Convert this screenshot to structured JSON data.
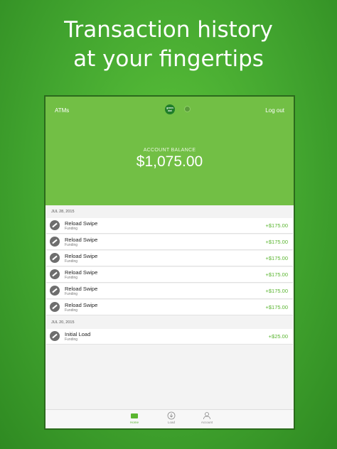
{
  "headline": {
    "line1": "Transaction history",
    "line2": "at your fingertips"
  },
  "topbar": {
    "left_link": "ATMs",
    "logo_text": "green dot",
    "right_link": "Log out"
  },
  "balance": {
    "label": "ACCOUNT BALANCE",
    "amount": "$1,075.00"
  },
  "groups": [
    {
      "date": "JUL 28, 2015",
      "items": [
        {
          "title": "Reload Swipe",
          "subtitle": "Funding",
          "amount": "+$175.00"
        },
        {
          "title": "Reload Swipe",
          "subtitle": "Funding",
          "amount": "+$175.00"
        },
        {
          "title": "Reload Swipe",
          "subtitle": "Funding",
          "amount": "+$175.00"
        },
        {
          "title": "Reload Swipe",
          "subtitle": "Funding",
          "amount": "+$175.00"
        },
        {
          "title": "Reload Swipe",
          "subtitle": "Funding",
          "amount": "+$175.00"
        },
        {
          "title": "Reload Swipe",
          "subtitle": "Funding",
          "amount": "+$175.00"
        }
      ]
    },
    {
      "date": "JUL 20, 2015",
      "items": [
        {
          "title": "Initial Load",
          "subtitle": "Funding",
          "amount": "+$25.00"
        }
      ]
    }
  ],
  "tabs": [
    {
      "label": "Home",
      "icon": "wallet-icon",
      "active": true
    },
    {
      "label": "Load",
      "icon": "download-icon",
      "active": false
    },
    {
      "label": "Account",
      "icon": "person-icon",
      "active": false
    }
  ],
  "colors": {
    "brand_green": "#72bf45",
    "amount_green": "#5ab530",
    "background": "#42a52f"
  }
}
